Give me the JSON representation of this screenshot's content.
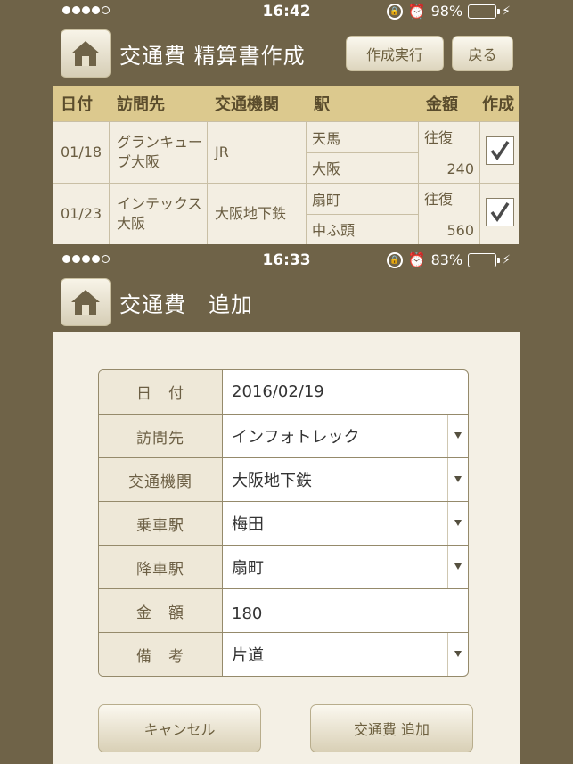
{
  "status_top": {
    "time": "16:42",
    "battery": "98%",
    "battery_level": 0.98
  },
  "status_bottom": {
    "time": "16:33",
    "battery": "83%",
    "battery_level": 0.83
  },
  "screen1": {
    "title": "交通費 精算書作成",
    "execute_label": "作成実行",
    "back_label": "戻る",
    "columns": [
      "日付",
      "訪問先",
      "交通機関",
      "駅",
      "金額",
      "作成"
    ],
    "rows": [
      {
        "date": "01/18",
        "destination": "グランキューブ大阪",
        "transport": "JR",
        "station_from": "天馬",
        "station_to": "大阪",
        "trip": "往復",
        "amount": "240",
        "checked": true
      },
      {
        "date": "01/23",
        "destination": "インテックス大阪",
        "transport": "大阪地下鉄",
        "station_from": "扇町",
        "station_to": "中ふ頭",
        "trip": "往復",
        "amount": "560",
        "checked": true
      }
    ]
  },
  "screen2": {
    "title": "交通費　追加",
    "fields": [
      {
        "label": "日　付",
        "value": "2016/02/19",
        "dropdown": false
      },
      {
        "label": "訪問先",
        "value": "インフォトレック",
        "dropdown": true
      },
      {
        "label": "交通機関",
        "value": "大阪地下鉄",
        "dropdown": true
      },
      {
        "label": "乗車駅",
        "value": "梅田",
        "dropdown": true
      },
      {
        "label": "降車駅",
        "value": "扇町",
        "dropdown": true
      },
      {
        "label": "金　額",
        "value": "180",
        "dropdown": false
      },
      {
        "label": "備　考",
        "value": "片道",
        "dropdown": true
      }
    ],
    "cancel_label": "キャンセル",
    "add_label": "交通費 追加"
  }
}
